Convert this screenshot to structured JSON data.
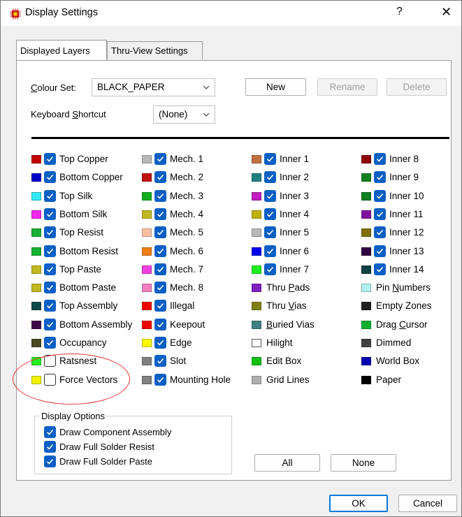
{
  "window": {
    "title": "Display Settings",
    "help": "?",
    "close": "✕"
  },
  "tabs": [
    {
      "label": "Displayed Layers",
      "active": true
    },
    {
      "label": "Thru-View Settings",
      "active": false
    }
  ],
  "colour_set": {
    "label_u": "C",
    "label_rest": "olour Set:",
    "value": "BLACK_PAPER"
  },
  "keyboard_shortcut": {
    "label_pre": "Keyboard ",
    "label_u": "S",
    "label_rest": "hortcut",
    "value": "(None)"
  },
  "buttons": {
    "new": "New",
    "rename": "Rename",
    "delete": "Delete",
    "all": "All",
    "none": "None",
    "ok": "OK",
    "cancel": "Cancel"
  },
  "layers": {
    "col1": [
      {
        "name": "Top Copper",
        "color": "#c00000",
        "checked": true
      },
      {
        "name": "Bottom Copper",
        "color": "#0000c8",
        "checked": true
      },
      {
        "name": "Top Silk",
        "color": "#33e8f5",
        "checked": true
      },
      {
        "name": "Bottom Silk",
        "color": "#f028f0",
        "checked": true
      },
      {
        "name": "Top Resist",
        "color": "#16b032",
        "checked": true
      },
      {
        "name": "Bottom Resist",
        "color": "#16b032",
        "checked": true
      },
      {
        "name": "Top Paste",
        "color": "#c0b820",
        "checked": true
      },
      {
        "name": "Bottom Paste",
        "color": "#c0b820",
        "checked": true
      },
      {
        "name": "Top Assembly",
        "color": "#0e4a4a",
        "checked": true
      },
      {
        "name": "Bottom Assembly",
        "color": "#3c0a4a",
        "checked": true
      },
      {
        "name": "Occupancy",
        "color": "#4a4a20",
        "checked": true
      },
      {
        "name": "Ratsnest",
        "color": "#22ee22",
        "checked": false
      },
      {
        "name": "Force Vectors",
        "color": "#f0f000",
        "checked": false
      }
    ],
    "col2": [
      {
        "name": "Mech. 1",
        "color": "#b8b8b8",
        "checked": true
      },
      {
        "name": "Mech. 2",
        "color": "#c01010",
        "checked": true
      },
      {
        "name": "Mech. 3",
        "color": "#10b020",
        "checked": true
      },
      {
        "name": "Mech. 4",
        "color": "#c0b820",
        "checked": true
      },
      {
        "name": "Mech. 5",
        "color": "#f8c0a0",
        "checked": true
      },
      {
        "name": "Mech. 6",
        "color": "#f08010",
        "checked": true
      },
      {
        "name": "Mech. 7",
        "color": "#f040e0",
        "checked": true
      },
      {
        "name": "Mech. 8",
        "color": "#f080c0",
        "checked": true
      },
      {
        "name": "Illegal",
        "color": "#f00000",
        "checked": true
      },
      {
        "name": "Keepout",
        "color": "#f00000",
        "checked": true
      },
      {
        "name": "Edge",
        "color": "#f8f800",
        "checked": true
      },
      {
        "name": "Slot",
        "color": "#808080",
        "checked": true
      },
      {
        "name": "Mounting Hole",
        "color": "#808080",
        "checked": true
      }
    ],
    "col3": [
      {
        "name": "Inner 1",
        "color": "#c07040",
        "checked": true,
        "u": ""
      },
      {
        "name": "Inner 2",
        "color": "#208080",
        "checked": true,
        "u": ""
      },
      {
        "name": "Inner 3",
        "color": "#c020c0",
        "checked": true,
        "u": ""
      },
      {
        "name": "Inner 4",
        "color": "#c0b000",
        "checked": true,
        "u": ""
      },
      {
        "name": "Inner 5",
        "color": "#b8b8b8",
        "checked": true,
        "u": ""
      },
      {
        "name": "Inner 6",
        "color": "#0000f0",
        "checked": true,
        "u": ""
      },
      {
        "name": "Inner 7",
        "color": "#20f020",
        "checked": true,
        "u": ""
      },
      {
        "name": "Thru Pads",
        "color": "#8020c0",
        "u_pre": "Thru ",
        "u": "P",
        "u_rest": "ads"
      },
      {
        "name": "Thru Vias",
        "color": "#808010",
        "u_pre": "Thru ",
        "u": "V",
        "u_rest": "ias"
      },
      {
        "name": "Buried Vias",
        "color": "#408080",
        "u_pre": "",
        "u": "B",
        "u_rest": "uried Vias"
      },
      {
        "name": "Hilight",
        "color": "#ffffff",
        "u_pre": "",
        "u": "",
        "u_rest": "Hilight"
      },
      {
        "name": "Edit Box",
        "color": "#10c010",
        "u_pre": "",
        "u": "",
        "u_rest": "Edit Box"
      },
      {
        "name": "Grid Lines",
        "color": "#b0b0b0",
        "u_pre": "",
        "u": "",
        "u_rest": "Grid Lines"
      }
    ],
    "col4": [
      {
        "name": "Inner 8",
        "color": "#900000",
        "checked": true
      },
      {
        "name": "Inner 9",
        "color": "#108020",
        "checked": true
      },
      {
        "name": "Inner 10",
        "color": "#108020",
        "checked": true
      },
      {
        "name": "Inner 11",
        "color": "#8010a0",
        "checked": true
      },
      {
        "name": "Inner 12",
        "color": "#807000",
        "checked": true
      },
      {
        "name": "Inner 13",
        "color": "#300040",
        "checked": true
      },
      {
        "name": "Inner 14",
        "color": "#104040",
        "checked": true
      },
      {
        "name": "Pin Numbers",
        "color": "#b0f0f0",
        "u_pre": "Pin ",
        "u": "N",
        "u_rest": "umbers"
      },
      {
        "name": "Empty Zones",
        "color": "#202020",
        "u_pre": "",
        "u": "",
        "u_rest": "Empty Zones"
      },
      {
        "name": "Drag Cursor",
        "color": "#10b030",
        "u_pre": "Drag ",
        "u": "C",
        "u_rest": "ursor"
      },
      {
        "name": "Dimmed",
        "color": "#404040",
        "u_pre": "",
        "u": "",
        "u_rest": "Dimmed"
      },
      {
        "name": "World Box",
        "color": "#0000b0",
        "u_pre": "",
        "u": "",
        "u_rest": "World Box"
      },
      {
        "name": "Paper",
        "color": "#000000",
        "u_pre": "",
        "u": "",
        "u_rest": "Paper"
      }
    ]
  },
  "display_options": {
    "title": "Display Options",
    "items": [
      {
        "label": "Draw Component Assembly",
        "checked": true
      },
      {
        "label": "Draw Full Solder Resist",
        "checked": true
      },
      {
        "label": "Draw Full Solder Paste",
        "checked": true
      }
    ]
  },
  "annotation": {
    "color": "#e8312f"
  }
}
